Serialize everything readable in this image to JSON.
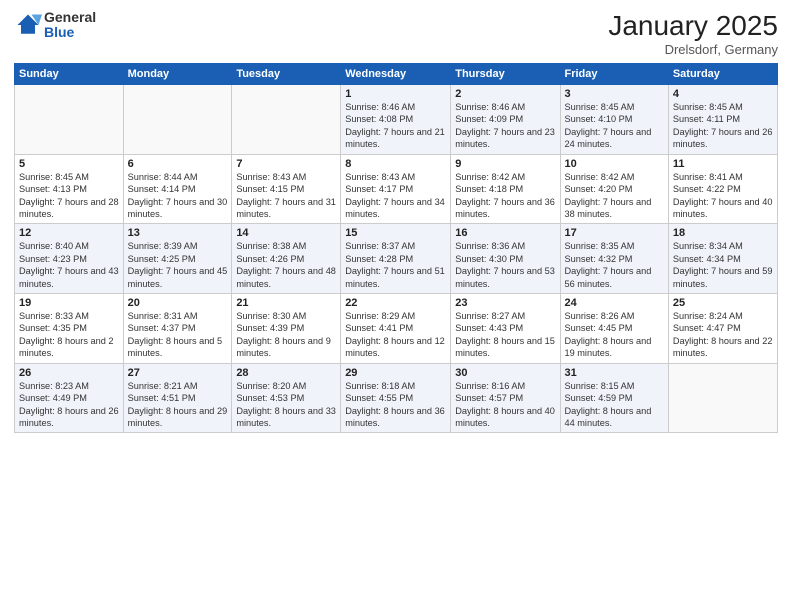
{
  "logo": {
    "general": "General",
    "blue": "Blue"
  },
  "title": "January 2025",
  "location": "Drelsdorf, Germany",
  "weekdays": [
    "Sunday",
    "Monday",
    "Tuesday",
    "Wednesday",
    "Thursday",
    "Friday",
    "Saturday"
  ],
  "weeks": [
    [
      {
        "day": "",
        "sunrise": "",
        "sunset": "",
        "daylight": ""
      },
      {
        "day": "",
        "sunrise": "",
        "sunset": "",
        "daylight": ""
      },
      {
        "day": "",
        "sunrise": "",
        "sunset": "",
        "daylight": ""
      },
      {
        "day": "1",
        "sunrise": "Sunrise: 8:46 AM",
        "sunset": "Sunset: 4:08 PM",
        "daylight": "Daylight: 7 hours and 21 minutes."
      },
      {
        "day": "2",
        "sunrise": "Sunrise: 8:46 AM",
        "sunset": "Sunset: 4:09 PM",
        "daylight": "Daylight: 7 hours and 23 minutes."
      },
      {
        "day": "3",
        "sunrise": "Sunrise: 8:45 AM",
        "sunset": "Sunset: 4:10 PM",
        "daylight": "Daylight: 7 hours and 24 minutes."
      },
      {
        "day": "4",
        "sunrise": "Sunrise: 8:45 AM",
        "sunset": "Sunset: 4:11 PM",
        "daylight": "Daylight: 7 hours and 26 minutes."
      }
    ],
    [
      {
        "day": "5",
        "sunrise": "Sunrise: 8:45 AM",
        "sunset": "Sunset: 4:13 PM",
        "daylight": "Daylight: 7 hours and 28 minutes."
      },
      {
        "day": "6",
        "sunrise": "Sunrise: 8:44 AM",
        "sunset": "Sunset: 4:14 PM",
        "daylight": "Daylight: 7 hours and 30 minutes."
      },
      {
        "day": "7",
        "sunrise": "Sunrise: 8:43 AM",
        "sunset": "Sunset: 4:15 PM",
        "daylight": "Daylight: 7 hours and 31 minutes."
      },
      {
        "day": "8",
        "sunrise": "Sunrise: 8:43 AM",
        "sunset": "Sunset: 4:17 PM",
        "daylight": "Daylight: 7 hours and 34 minutes."
      },
      {
        "day": "9",
        "sunrise": "Sunrise: 8:42 AM",
        "sunset": "Sunset: 4:18 PM",
        "daylight": "Daylight: 7 hours and 36 minutes."
      },
      {
        "day": "10",
        "sunrise": "Sunrise: 8:42 AM",
        "sunset": "Sunset: 4:20 PM",
        "daylight": "Daylight: 7 hours and 38 minutes."
      },
      {
        "day": "11",
        "sunrise": "Sunrise: 8:41 AM",
        "sunset": "Sunset: 4:22 PM",
        "daylight": "Daylight: 7 hours and 40 minutes."
      }
    ],
    [
      {
        "day": "12",
        "sunrise": "Sunrise: 8:40 AM",
        "sunset": "Sunset: 4:23 PM",
        "daylight": "Daylight: 7 hours and 43 minutes."
      },
      {
        "day": "13",
        "sunrise": "Sunrise: 8:39 AM",
        "sunset": "Sunset: 4:25 PM",
        "daylight": "Daylight: 7 hours and 45 minutes."
      },
      {
        "day": "14",
        "sunrise": "Sunrise: 8:38 AM",
        "sunset": "Sunset: 4:26 PM",
        "daylight": "Daylight: 7 hours and 48 minutes."
      },
      {
        "day": "15",
        "sunrise": "Sunrise: 8:37 AM",
        "sunset": "Sunset: 4:28 PM",
        "daylight": "Daylight: 7 hours and 51 minutes."
      },
      {
        "day": "16",
        "sunrise": "Sunrise: 8:36 AM",
        "sunset": "Sunset: 4:30 PM",
        "daylight": "Daylight: 7 hours and 53 minutes."
      },
      {
        "day": "17",
        "sunrise": "Sunrise: 8:35 AM",
        "sunset": "Sunset: 4:32 PM",
        "daylight": "Daylight: 7 hours and 56 minutes."
      },
      {
        "day": "18",
        "sunrise": "Sunrise: 8:34 AM",
        "sunset": "Sunset: 4:34 PM",
        "daylight": "Daylight: 7 hours and 59 minutes."
      }
    ],
    [
      {
        "day": "19",
        "sunrise": "Sunrise: 8:33 AM",
        "sunset": "Sunset: 4:35 PM",
        "daylight": "Daylight: 8 hours and 2 minutes."
      },
      {
        "day": "20",
        "sunrise": "Sunrise: 8:31 AM",
        "sunset": "Sunset: 4:37 PM",
        "daylight": "Daylight: 8 hours and 5 minutes."
      },
      {
        "day": "21",
        "sunrise": "Sunrise: 8:30 AM",
        "sunset": "Sunset: 4:39 PM",
        "daylight": "Daylight: 8 hours and 9 minutes."
      },
      {
        "day": "22",
        "sunrise": "Sunrise: 8:29 AM",
        "sunset": "Sunset: 4:41 PM",
        "daylight": "Daylight: 8 hours and 12 minutes."
      },
      {
        "day": "23",
        "sunrise": "Sunrise: 8:27 AM",
        "sunset": "Sunset: 4:43 PM",
        "daylight": "Daylight: 8 hours and 15 minutes."
      },
      {
        "day": "24",
        "sunrise": "Sunrise: 8:26 AM",
        "sunset": "Sunset: 4:45 PM",
        "daylight": "Daylight: 8 hours and 19 minutes."
      },
      {
        "day": "25",
        "sunrise": "Sunrise: 8:24 AM",
        "sunset": "Sunset: 4:47 PM",
        "daylight": "Daylight: 8 hours and 22 minutes."
      }
    ],
    [
      {
        "day": "26",
        "sunrise": "Sunrise: 8:23 AM",
        "sunset": "Sunset: 4:49 PM",
        "daylight": "Daylight: 8 hours and 26 minutes."
      },
      {
        "day": "27",
        "sunrise": "Sunrise: 8:21 AM",
        "sunset": "Sunset: 4:51 PM",
        "daylight": "Daylight: 8 hours and 29 minutes."
      },
      {
        "day": "28",
        "sunrise": "Sunrise: 8:20 AM",
        "sunset": "Sunset: 4:53 PM",
        "daylight": "Daylight: 8 hours and 33 minutes."
      },
      {
        "day": "29",
        "sunrise": "Sunrise: 8:18 AM",
        "sunset": "Sunset: 4:55 PM",
        "daylight": "Daylight: 8 hours and 36 minutes."
      },
      {
        "day": "30",
        "sunrise": "Sunrise: 8:16 AM",
        "sunset": "Sunset: 4:57 PM",
        "daylight": "Daylight: 8 hours and 40 minutes."
      },
      {
        "day": "31",
        "sunrise": "Sunrise: 8:15 AM",
        "sunset": "Sunset: 4:59 PM",
        "daylight": "Daylight: 8 hours and 44 minutes."
      },
      {
        "day": "",
        "sunrise": "",
        "sunset": "",
        "daylight": ""
      }
    ]
  ]
}
